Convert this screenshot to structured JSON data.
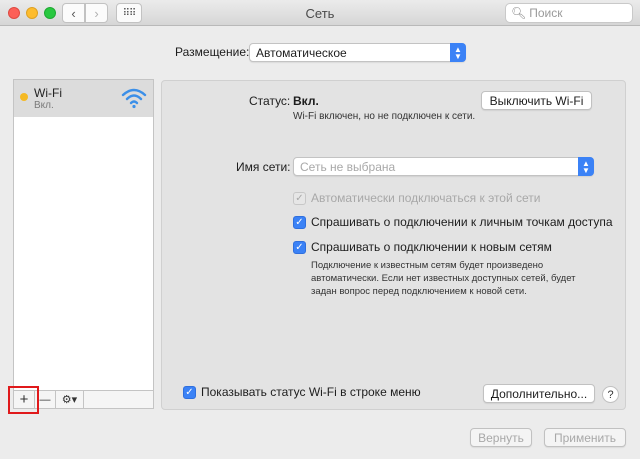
{
  "window": {
    "title": "Сеть",
    "search_placeholder": "Поиск",
    "nav_back": "‹",
    "nav_forward": "›",
    "nav_grid": "⠿⠿"
  },
  "location": {
    "label": "Размещение:",
    "value": "Автоматическое"
  },
  "sidebar": {
    "items": [
      {
        "name": "Wi-Fi",
        "status": "Вкл.",
        "status_color": "#f5b923",
        "icon": "wifi-icon"
      }
    ],
    "toolbar": {
      "add": "+",
      "remove": "—",
      "gear": "⚙▾"
    }
  },
  "panel": {
    "status_label": "Статус:",
    "status_value": "Вкл.",
    "status_description": "Wi-Fi включен, но не подключен к сети.",
    "turn_off_button": "Выключить Wi-Fi",
    "network_name_label": "Имя сети:",
    "network_name_placeholder": "Сеть не выбрана",
    "options": [
      {
        "label": "Автоматически подключаться к этой сети",
        "checked": true,
        "enabled": false
      },
      {
        "label": "Спрашивать о подключении к личным точкам доступа",
        "checked": true,
        "enabled": true
      },
      {
        "label": "Спрашивать о подключении к новым сетям",
        "checked": true,
        "enabled": true
      }
    ],
    "note": "Подключение к известным сетям будет произведено автоматически. Если нет известных доступных сетей, будет задан вопрос перед подключением к новой сети.",
    "show_status_in_menu": {
      "label": "Показывать статус Wi-Fi в строке меню",
      "checked": true
    },
    "advanced_button": "Дополнительно...",
    "help": "?"
  },
  "footer": {
    "revert_button": "Вернуть",
    "apply_button": "Применить"
  },
  "colors": {
    "accent": "#3b82f6",
    "highlight_box": "#e0191b"
  }
}
